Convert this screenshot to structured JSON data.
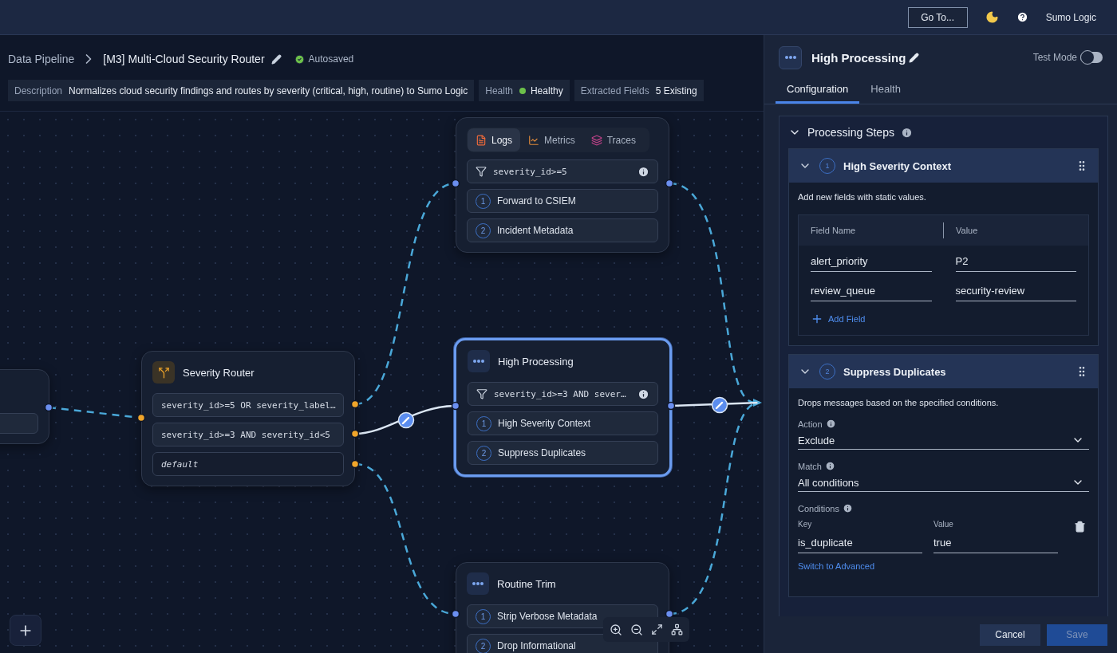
{
  "top_bar": {
    "goto_button": "Go To...",
    "brand": "Sumo Logic"
  },
  "breadcrumb": {
    "items": [
      "Data Pipeline",
      "[M3] Multi-Cloud Security Router"
    ],
    "status": "Autosaved"
  },
  "info_chips": [
    {
      "label": "Description",
      "value": "Normalizes cloud security findings and routes by severity (critical, high, routine) to Sumo Logic",
      "kind": "text"
    },
    {
      "label": "Health",
      "value": "Healthy",
      "kind": "status"
    },
    {
      "label": "Extracted Fields",
      "value": "5 Existing",
      "kind": "text"
    }
  ],
  "canvas": {
    "nodes": [
      {
        "kind": "partial"
      },
      {
        "kind": "router",
        "title": "Severity Router",
        "selected": false,
        "routes": [
          {
            "text": "severity_id>=5 OR severity_label…",
            "kind": "condition"
          },
          {
            "text": "severity_id>=3 AND severity_id<5",
            "kind": "condition"
          },
          {
            "text": "default",
            "kind": "default"
          }
        ]
      },
      {
        "kind": "destination",
        "selected": false,
        "tabs": [
          {
            "label": "Logs",
            "selected": true,
            "kind": "logs"
          },
          {
            "label": "Metrics",
            "selected": false,
            "kind": "metrics"
          },
          {
            "label": "Traces",
            "selected": false,
            "kind": "traces"
          }
        ],
        "filter": "severity_id>=5",
        "steps": [
          {
            "number": "1",
            "label": "Forward to CSIEM"
          },
          {
            "number": "2",
            "label": "Incident Metadata"
          }
        ]
      },
      {
        "kind": "processing",
        "title": "High Processing",
        "selected": true,
        "filter": "severity_id>=3 AND sever…",
        "steps": [
          {
            "number": "1",
            "label": "High Severity Context"
          },
          {
            "number": "2",
            "label": "Suppress Duplicates"
          }
        ]
      },
      {
        "kind": "processing",
        "title": "Routine Trim",
        "selected": false,
        "steps": [
          {
            "number": "1",
            "label": "Strip Verbose Metadata"
          },
          {
            "number": "2",
            "label": "Drop Informational"
          }
        ]
      }
    ]
  },
  "panel": {
    "title": "High Processing",
    "test_mode": {
      "label": "Test Mode",
      "on": false
    },
    "tabs": [
      {
        "label": "Configuration",
        "selected": true
      },
      {
        "label": "Health",
        "selected": false
      }
    ],
    "section": {
      "title": "Processing Steps",
      "expanded": true
    },
    "steps": [
      {
        "number": "1",
        "title": "High Severity Context",
        "expanded": true,
        "kind": "add_fields",
        "description": "Add new fields with static values.",
        "columns": [
          "Field Name",
          "Value"
        ],
        "rows": [
          {
            "name": "alert_priority",
            "value": "P2"
          },
          {
            "name": "review_queue",
            "value": "security-review"
          }
        ],
        "add_label": "Add Field"
      },
      {
        "number": "2",
        "title": "Suppress Duplicates",
        "expanded": true,
        "kind": "filter",
        "description": "Drops messages based on the specified conditions.",
        "action": {
          "label": "Action",
          "value": "Exclude"
        },
        "match": {
          "label": "Match",
          "value": "All conditions"
        },
        "conditions": {
          "label": "Conditions",
          "key_label": "Key",
          "value_label": "Value",
          "rows": [
            {
              "key": "is_duplicate",
              "value": "true"
            }
          ]
        },
        "switch_link": "Switch to Advanced"
      }
    ],
    "footer": {
      "cancel": "Cancel",
      "save": {
        "label": "Save",
        "disabled": true
      }
    }
  }
}
